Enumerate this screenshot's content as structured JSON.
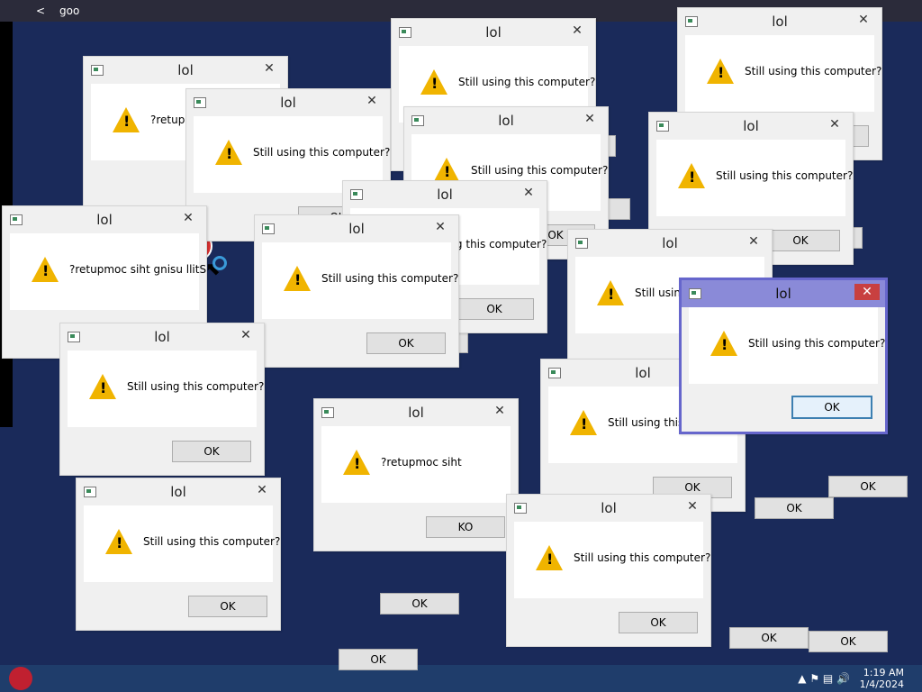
{
  "browser": {
    "tab_label": "goo",
    "back_glyph": "<"
  },
  "dialog_title": "lol",
  "dialogs": [
    {
      "msg": "Still using this computer?",
      "ok": "OK"
    },
    {
      "msg": "?retupm",
      "ok": "OK"
    },
    {
      "msg": "Still using this computer?",
      "ok": "OK"
    },
    {
      "msg": "Still using this computer?",
      "ok": "OK"
    },
    {
      "msg": "Still using this computer?",
      "ok": "OK"
    },
    {
      "msg": "Still using this computer?",
      "ok": "OK"
    },
    {
      "msg": "Still using this computer?",
      "ok": "OK"
    },
    {
      "msg": "?retupmoc siht gnisu llitS",
      "ok": "OK"
    },
    {
      "msg": "Still using this computer?",
      "ok": "OK"
    },
    {
      "msg": "Still using this computer?",
      "ok": "OK"
    },
    {
      "msg": "Still using this computer?",
      "ok": "OK"
    },
    {
      "msg": "Still using this computer?",
      "ok": "OK"
    },
    {
      "msg": "?retupmoc siht",
      "ok": "KO"
    },
    {
      "msg": "Still using this computer?",
      "ok": "OK"
    },
    {
      "msg": "Still using this computer?",
      "ok": "OK"
    },
    {
      "msg": "Still using this computer?",
      "ok": "OK"
    }
  ],
  "fragments": {
    "stray_ok": [
      "OK",
      "OK",
      "OK",
      "OK",
      "OK",
      "OK",
      "KO",
      "OK",
      "OK",
      "OK",
      "OK"
    ],
    "stray_q": [
      "uter?",
      "uter?",
      "outer?",
      "using t",
      "isu",
      "using this computer?"
    ],
    "stray_lol": "lol"
  },
  "taskbar": {
    "date": "1/4/2024",
    "time": "1:19 AM"
  },
  "colors": {
    "accent_active": "#6666cc",
    "warning": "#f0b400",
    "error": "#d83030"
  },
  "icons": {
    "dialog_icon": "warning-icon",
    "close": "close-icon",
    "error": "error-icon"
  }
}
